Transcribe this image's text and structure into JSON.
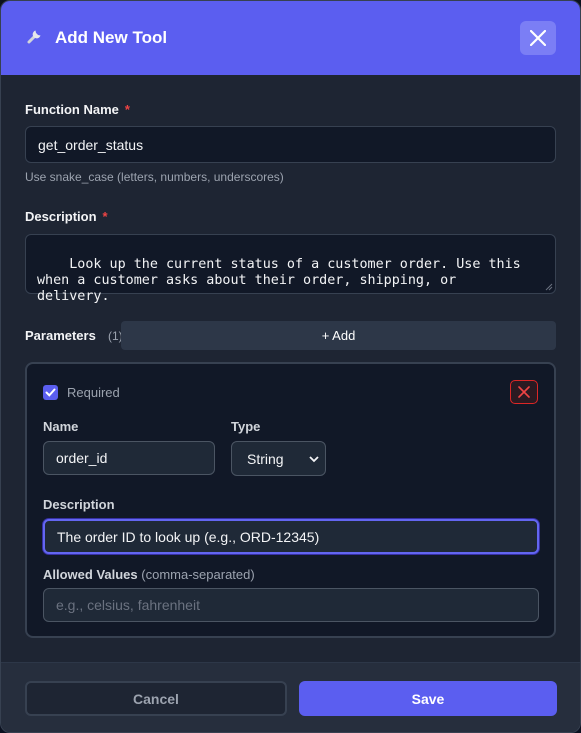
{
  "dialog": {
    "title": "Add New Tool",
    "icon": "wrench-icon",
    "close_icon": "close-icon"
  },
  "function_name": {
    "label": "Function Name",
    "required_mark": "*",
    "value": "get_order_status",
    "hint": "Use snake_case (letters, numbers, underscores)"
  },
  "description": {
    "label": "Description",
    "required_mark": "*",
    "value": "Look up the current status of a customer order. Use this\nwhen a customer asks about their order, shipping, or\ndelivery."
  },
  "parameters": {
    "label": "Parameters",
    "count": "(1)",
    "add_label": "+ Add",
    "items": [
      {
        "required_label": "Required",
        "required_checked": true,
        "name_label": "Name",
        "name_value": "order_id",
        "type_label": "Type",
        "type_value": "String",
        "description_label": "Description",
        "description_value": "The order ID to look up (e.g., ORD-12345)",
        "allowed_label": "Allowed Values",
        "allowed_hint": "(comma-separated)",
        "allowed_placeholder": "e.g., celsius, fahrenheit"
      }
    ]
  },
  "footer": {
    "cancel_label": "Cancel",
    "save_label": "Save"
  },
  "colors": {
    "accent": "#5b5ef0",
    "danger": "#ef4444",
    "background": "#1e2533"
  }
}
